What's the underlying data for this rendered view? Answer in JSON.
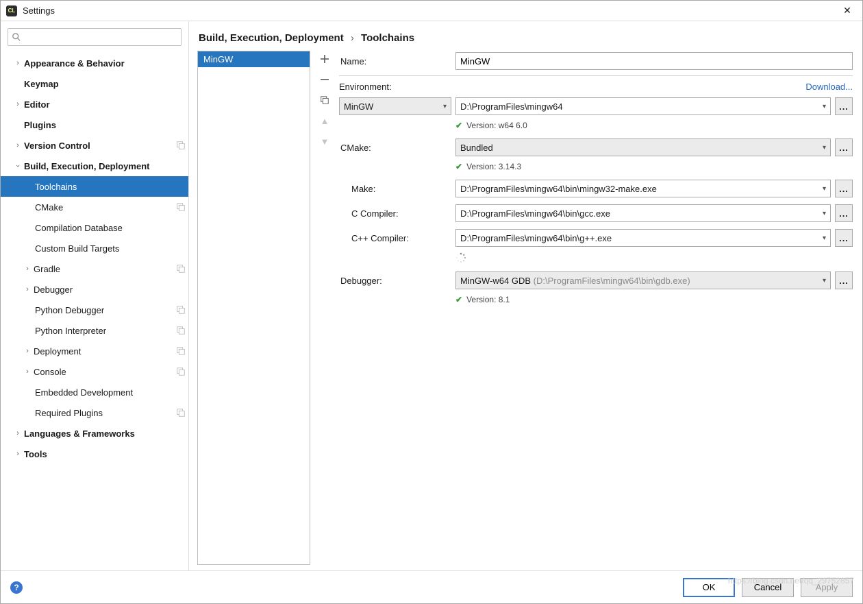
{
  "window": {
    "title": "Settings"
  },
  "search": {
    "placeholder": ""
  },
  "tree": {
    "appearance": "Appearance & Behavior",
    "keymap": "Keymap",
    "editor": "Editor",
    "plugins": "Plugins",
    "vcs": "Version Control",
    "bed": "Build, Execution, Deployment",
    "bed_items": {
      "toolchains": "Toolchains",
      "cmake": "CMake",
      "compdb": "Compilation Database",
      "cbt": "Custom Build Targets",
      "gradle": "Gradle",
      "debugger": "Debugger",
      "pydbg": "Python Debugger",
      "pyint": "Python Interpreter",
      "deploy": "Deployment",
      "console": "Console",
      "embdev": "Embedded Development",
      "reqplug": "Required Plugins"
    },
    "langfw": "Languages & Frameworks",
    "tools": "Tools"
  },
  "breadcrumb": {
    "root": "Build, Execution, Deployment",
    "leaf": "Toolchains"
  },
  "list": {
    "items": [
      "MinGW"
    ]
  },
  "form": {
    "labels": {
      "name": "Name:",
      "env": "Environment:",
      "cmake": "CMake:",
      "make": "Make:",
      "cc": "C Compiler:",
      "cxx": "C++ Compiler:",
      "dbg": "Debugger:"
    },
    "download": "Download...",
    "values": {
      "name": "MinGW",
      "env_combo": "MinGW",
      "env_path": "D:\\ProgramFiles\\mingw64",
      "cmake": "Bundled",
      "make": "D:\\ProgramFiles\\mingw64\\bin\\mingw32-make.exe",
      "cc": "D:\\ProgramFiles\\mingw64\\bin\\gcc.exe",
      "cxx": "D:\\ProgramFiles\\mingw64\\bin\\g++.exe",
      "dbg_main": "MinGW-w64 GDB ",
      "dbg_hint": "(D:\\ProgramFiles\\mingw64\\bin\\gdb.exe)"
    },
    "status": {
      "env": "Version: w64 6.0",
      "cmake": "Version: 3.14.3",
      "dbg": "Version: 8.1"
    }
  },
  "buttons": {
    "ok": "OK",
    "cancel": "Cancel",
    "apply": "Apply"
  },
  "watermark": "https://blog.csdn.net/qq_29752857"
}
